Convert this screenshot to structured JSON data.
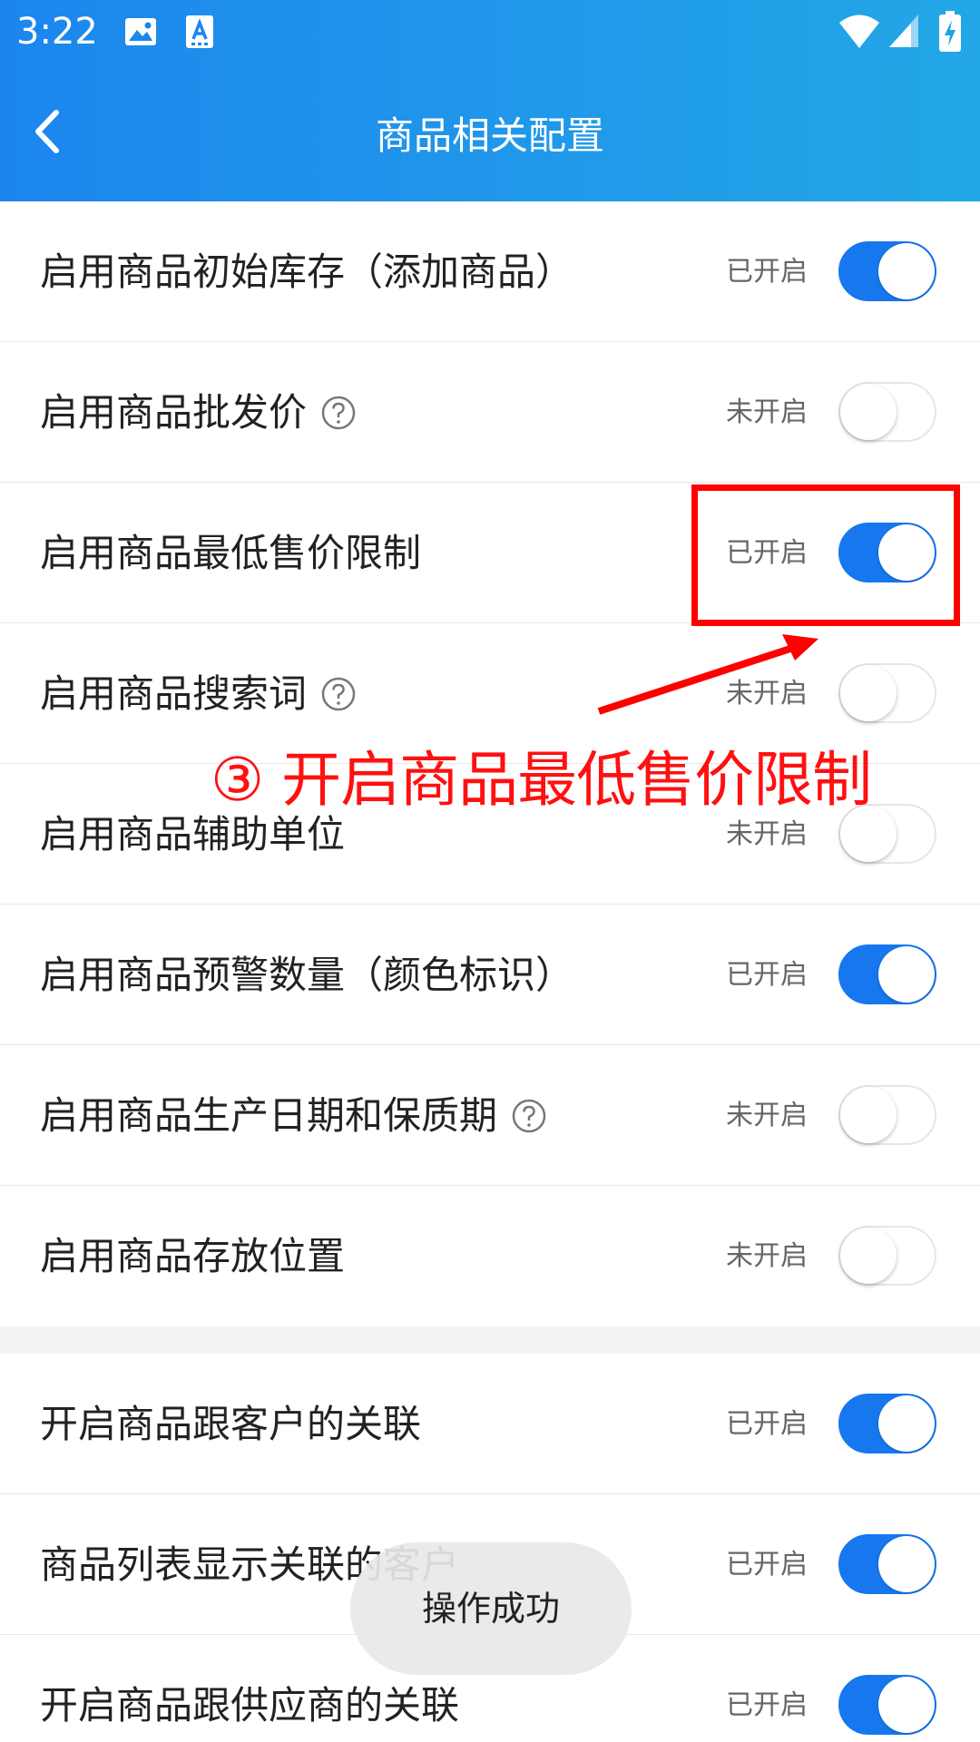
{
  "status_bar": {
    "time": "3:22",
    "icons": [
      "image-icon",
      "a-icon",
      "wifi-icon",
      "signal-icon",
      "battery-icon"
    ]
  },
  "header": {
    "title": "商品相关配置",
    "back_icon": "chevron-left-icon",
    "gradient": [
      "#1c86ee",
      "#23a7e6"
    ]
  },
  "settings": [
    {
      "label": "启用商品初始库存（添加商品）",
      "status": "已开启",
      "enabled": true,
      "help": false
    },
    {
      "label": "启用商品批发价",
      "status": "未开启",
      "enabled": false,
      "help": true
    },
    {
      "label": "启用商品最低售价限制",
      "status": "已开启",
      "enabled": true,
      "help": false
    },
    {
      "label": "启用商品搜索词",
      "status": "未开启",
      "enabled": false,
      "help": true
    },
    {
      "label": "启用商品辅助单位",
      "status": "未开启",
      "enabled": false,
      "help": false
    },
    {
      "label": "启用商品预警数量（颜色标识）",
      "status": "已开启",
      "enabled": true,
      "help": false
    },
    {
      "label": "启用商品生产日期和保质期",
      "status": "未开启",
      "enabled": false,
      "help": true
    },
    {
      "label": "启用商品存放位置",
      "status": "未开启",
      "enabled": false,
      "help": false
    }
  ],
  "settings2": [
    {
      "label": "开启商品跟客户的关联",
      "status": "已开启",
      "enabled": true
    },
    {
      "label": "商品列表显示关联的客户",
      "status": "已开启",
      "enabled": true
    },
    {
      "label": "开启商品跟供应商的关联",
      "status": "已开启",
      "enabled": true
    }
  ],
  "annotation": {
    "text": "③ 开启商品最低售价限制",
    "color": "#ff0000"
  },
  "toast": {
    "text": "操作成功"
  },
  "colors": {
    "toggle_on": "#1677ee",
    "status_text": "#666666"
  }
}
